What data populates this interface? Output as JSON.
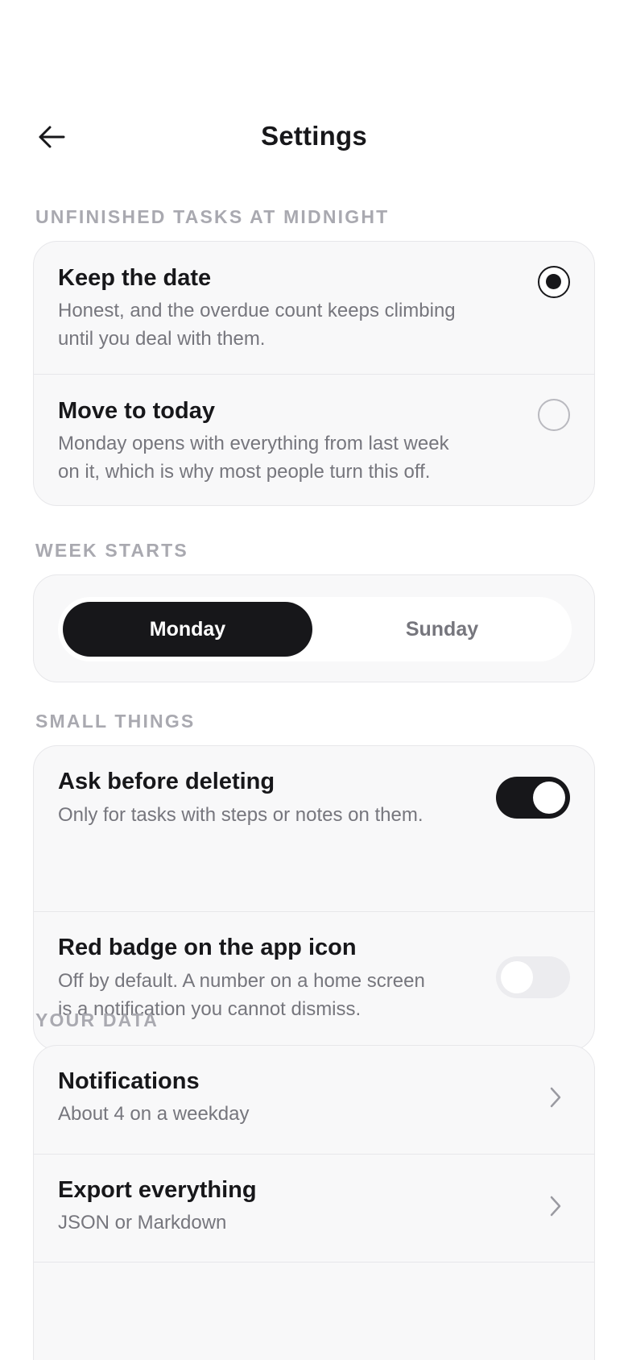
{
  "header": {
    "title": "Settings",
    "back_icon": "arrow-left-icon"
  },
  "sections": {
    "midnight": {
      "label": "UNFINISHED TASKS AT MIDNIGHT",
      "options": [
        {
          "title": "Keep the date",
          "desc_line1": "Honest, and the overdue count keeps climbing",
          "desc_line2": "until you deal with them.",
          "selected": true
        },
        {
          "title": "Move to today",
          "desc_line1": "Monday opens with everything from last week",
          "desc_line2": "on it, which is why most people turn this off.",
          "selected": false
        }
      ]
    },
    "week": {
      "label": "WEEK STARTS",
      "options": [
        "Monday",
        "Sunday"
      ],
      "selected": "Monday"
    },
    "small": {
      "label": "SMALL THINGS",
      "items": [
        {
          "title": "Ask before deleting",
          "desc_line1": "Only for tasks with steps or notes on them.",
          "enabled": true
        },
        {
          "title": "Red badge on the app icon",
          "desc_line1": "Off by default. A number on a home screen",
          "desc_line2": "is a notification you cannot dismiss.",
          "enabled": false
        }
      ]
    },
    "data": {
      "label": "YOUR DATA",
      "items": [
        {
          "title": "Notifications",
          "subtitle": "About 4 on a weekday",
          "icon": "chevron-right-icon"
        },
        {
          "title": "Export everything",
          "subtitle": "JSON or Markdown",
          "icon": "chevron-right-icon"
        }
      ]
    }
  },
  "colors": {
    "accent": "#17171a",
    "muted_text": "#76767d",
    "section_label": "#a9a9b0",
    "card_bg": "#f8f8f9",
    "border": "#e7e7ea"
  }
}
